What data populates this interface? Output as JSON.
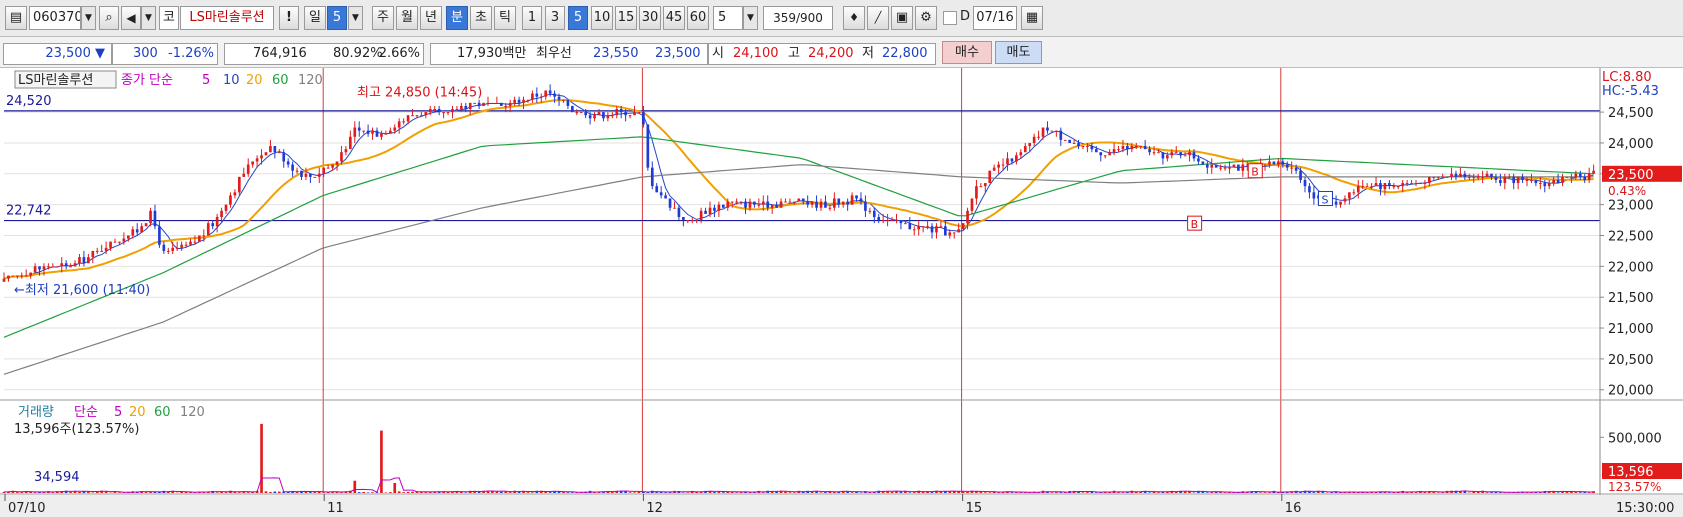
{
  "toolbar": {
    "code": "060370",
    "market": "코",
    "stock_name": "LS마린솔루션",
    "alert": "!",
    "period_day": "일",
    "period_day_value": "5",
    "period_week": "주",
    "period_month": "월",
    "period_year": "년",
    "period_min": "분",
    "period_sec": "초",
    "period_tick": "틱",
    "intervals": [
      "1",
      "3",
      "5",
      "10",
      "15",
      "30",
      "45",
      "60"
    ],
    "selected_interval": "5",
    "interval_value": "5",
    "count": "359",
    "count_total": "/900",
    "date_value": "07/16",
    "date_checkbox_label": "D"
  },
  "quote": {
    "price": "23,500",
    "change_arrow": "▼",
    "change": "300",
    "change_pct": "-1.26%",
    "volume": "764,916",
    "volume_ratio": "80.92%",
    "turnover_pct": "2.66%",
    "amount": "17,930백만",
    "ask_label": "최우선",
    "ask": "23,550",
    "bid": "23,500",
    "open_label": "시",
    "open": "24,100",
    "high_label": "고",
    "high": "24,200",
    "low_label": "저",
    "low": "22,800",
    "buy_button": "매수",
    "sell_button": "매도"
  },
  "chart_data": {
    "type": "candlestick",
    "price_legend": {
      "name": "LS마린솔루션",
      "ma_prefix": "종가 단순",
      "periods": [
        "5",
        "10",
        "20",
        "60",
        "120"
      ]
    },
    "volume_legend": {
      "name": "거래량",
      "ma_prefix": "단순",
      "periods": [
        "5",
        "20",
        "60",
        "120"
      ]
    },
    "y_ticks": [
      20000,
      20500,
      21000,
      21500,
      22000,
      22500,
      23000,
      23500,
      24000,
      24500
    ],
    "y_tick_labels": [
      "20,000",
      "20,500",
      "21,000",
      "21,500",
      "22,000",
      "22,500",
      "23,000",
      "23,500",
      "24,000",
      "24,500"
    ],
    "ylim": [
      19850,
      25150
    ],
    "x_labels": [
      "07/10",
      "11",
      "12",
      "15",
      "16"
    ],
    "session_breaks": [
      1,
      2,
      3,
      4
    ],
    "time_label": "15:30:00",
    "hlines": [
      {
        "value": 24520,
        "label": "24,520"
      },
      {
        "value": 22742,
        "label": "22,742"
      }
    ],
    "lc_label": "LC:8.80",
    "hc_label": "HC:-5.43",
    "current_price_label": "23,500",
    "current_pct_label": "0.43%",
    "annotations": {
      "high": {
        "value": 24850,
        "text": "최고 24,850 (14:45)"
      },
      "low": {
        "value": 21600,
        "text": "최저 21,600 (11:40)"
      }
    },
    "signals": [
      {
        "day": 3.73,
        "value": 22700,
        "text": "B"
      },
      {
        "day": 3.92,
        "value": 23550,
        "text": "B"
      },
      {
        "day": 4.14,
        "value": 23100,
        "text": "S"
      }
    ],
    "volume_info": "13,596주(123.57%)",
    "volume_avg_label": "34,594",
    "volume_axis_label": "500,000",
    "volume_current_label": "13,596",
    "volume_current_pct": "123.57%",
    "volume_max": 700000,
    "volume_tick_value": 500000,
    "ma_colors": {
      "ma5": "#2446c8",
      "ma20": "#f0a000",
      "ma60": "#20a040",
      "ma120": "#808080"
    },
    "price_anchors": [
      [
        0.0,
        21750
      ],
      [
        0.04,
        21850
      ],
      [
        0.12,
        22000
      ],
      [
        0.2,
        22000
      ],
      [
        0.26,
        22150
      ],
      [
        0.34,
        22400
      ],
      [
        0.42,
        22600
      ],
      [
        0.46,
        22850
      ],
      [
        0.5,
        22200
      ],
      [
        0.56,
        22300
      ],
      [
        0.62,
        22500
      ],
      [
        0.66,
        22750
      ],
      [
        0.72,
        23250
      ],
      [
        0.78,
        23750
      ],
      [
        0.84,
        23950
      ],
      [
        0.9,
        23600
      ],
      [
        0.96,
        23450
      ],
      [
        1.04,
        23700
      ],
      [
        1.1,
        24200
      ],
      [
        1.18,
        24150
      ],
      [
        1.24,
        24350
      ],
      [
        1.3,
        24500
      ],
      [
        1.38,
        24450
      ],
      [
        1.46,
        24650
      ],
      [
        1.55,
        24600
      ],
      [
        1.62,
        24700
      ],
      [
        1.7,
        24820
      ],
      [
        1.78,
        24560
      ],
      [
        1.84,
        24450
      ],
      [
        1.92,
        24500
      ],
      [
        2.0,
        24450
      ],
      [
        2.02,
        23450
      ],
      [
        2.06,
        23150
      ],
      [
        2.14,
        22700
      ],
      [
        2.2,
        22900
      ],
      [
        2.28,
        23050
      ],
      [
        2.38,
        23000
      ],
      [
        2.48,
        23050
      ],
      [
        2.58,
        23000
      ],
      [
        2.66,
        23100
      ],
      [
        2.74,
        22800
      ],
      [
        2.84,
        22650
      ],
      [
        2.92,
        22600
      ],
      [
        2.98,
        22500
      ],
      [
        3.0,
        22600
      ],
      [
        3.04,
        23250
      ],
      [
        3.1,
        23550
      ],
      [
        3.18,
        23800
      ],
      [
        3.26,
        24250
      ],
      [
        3.32,
        24100
      ],
      [
        3.38,
        23900
      ],
      [
        3.46,
        23850
      ],
      [
        3.54,
        23950
      ],
      [
        3.62,
        23800
      ],
      [
        3.7,
        23850
      ],
      [
        3.78,
        23600
      ],
      [
        3.84,
        23650
      ],
      [
        3.92,
        23550
      ],
      [
        4.0,
        23700
      ],
      [
        4.04,
        23600
      ],
      [
        4.1,
        23150
      ],
      [
        4.18,
        23050
      ],
      [
        4.26,
        23350
      ],
      [
        4.34,
        23300
      ],
      [
        4.42,
        23350
      ],
      [
        4.5,
        23450
      ],
      [
        4.6,
        23500
      ],
      [
        4.7,
        23400
      ],
      [
        4.8,
        23350
      ],
      [
        4.9,
        23400
      ],
      [
        4.98,
        23500
      ]
    ],
    "ma60_anchors": [
      [
        0.0,
        20850
      ],
      [
        0.5,
        21900
      ],
      [
        1.0,
        23150
      ],
      [
        1.5,
        23950
      ],
      [
        2.0,
        24100
      ],
      [
        2.5,
        23750
      ],
      [
        3.0,
        22800
      ],
      [
        3.5,
        23550
      ],
      [
        4.0,
        23750
      ],
      [
        4.98,
        23500
      ]
    ],
    "ma120_anchors": [
      [
        0.0,
        20250
      ],
      [
        0.5,
        21100
      ],
      [
        1.0,
        22300
      ],
      [
        1.5,
        22950
      ],
      [
        2.0,
        23450
      ],
      [
        2.5,
        23650
      ],
      [
        3.0,
        23450
      ],
      [
        3.5,
        23350
      ],
      [
        4.0,
        23450
      ],
      [
        4.98,
        23450
      ]
    ]
  }
}
